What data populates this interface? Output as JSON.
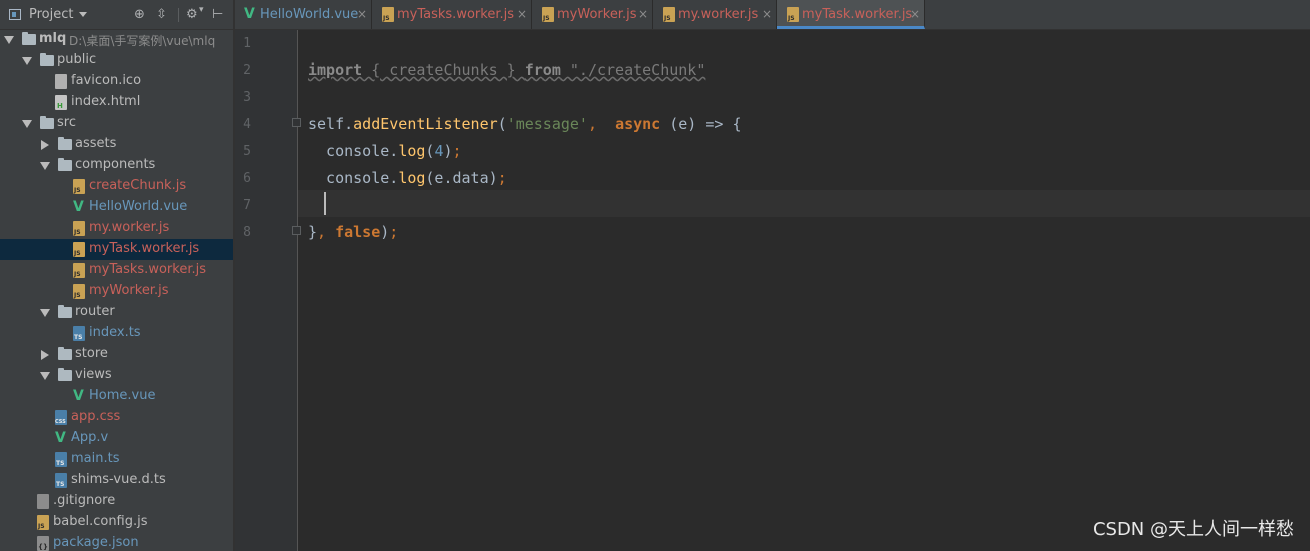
{
  "sidebar": {
    "title": "Project",
    "tree": [
      {
        "label": "mlq",
        "path": "D:\\桌面\\手写案例\\vue\\mlq",
        "kind": "folder",
        "expanded": true
      },
      {
        "label": "public",
        "kind": "folder",
        "expanded": true
      },
      {
        "label": "favicon.ico",
        "kind": "ico",
        "color": "#bbbbbb"
      },
      {
        "label": "index.html",
        "kind": "html",
        "color": "#bbbbbb"
      },
      {
        "label": "src",
        "kind": "folder",
        "expanded": true
      },
      {
        "label": "assets",
        "kind": "folder",
        "expanded": false
      },
      {
        "label": "components",
        "kind": "folder",
        "expanded": true
      },
      {
        "label": "createChunk.js",
        "kind": "js",
        "color": "#c8615a"
      },
      {
        "label": "HelloWorld.vue",
        "kind": "vue",
        "color": "#6897bb"
      },
      {
        "label": "my.worker.js",
        "kind": "js",
        "color": "#c8615a"
      },
      {
        "label": "myTask.worker.js",
        "kind": "js",
        "color": "#c8615a",
        "selected": true
      },
      {
        "label": "myTasks.worker.js",
        "kind": "js",
        "color": "#c8615a"
      },
      {
        "label": "myWorker.js",
        "kind": "js",
        "color": "#c8615a"
      },
      {
        "label": "router",
        "kind": "folder",
        "expanded": true
      },
      {
        "label": "index.ts",
        "kind": "ts",
        "color": "#6897bb"
      },
      {
        "label": "store",
        "kind": "folder",
        "expanded": false
      },
      {
        "label": "views",
        "kind": "folder",
        "expanded": true
      },
      {
        "label": "Home.vue",
        "kind": "vue",
        "color": "#6897bb"
      },
      {
        "label": "app.css",
        "kind": "css",
        "color": "#c8615a"
      },
      {
        "label": "App.v",
        "kind": "vue",
        "color": "#6897bb"
      },
      {
        "label": "main.ts",
        "kind": "ts",
        "color": "#6897bb"
      },
      {
        "label": "shims-vue.d.ts",
        "kind": "ts",
        "color": "#bbbbbb"
      },
      {
        "label": ".gitignore",
        "kind": "text",
        "color": "#bbbbbb"
      },
      {
        "label": "babel.config.js",
        "kind": "js",
        "color": "#bbbbbb"
      },
      {
        "label": "package.json",
        "kind": "json",
        "color": "#6897bb"
      }
    ]
  },
  "tabs": [
    {
      "label": "HelloWorld.vue",
      "kind": "vue",
      "color": "#6897bb",
      "active": false
    },
    {
      "label": "myTasks.worker.js",
      "kind": "js",
      "color": "#c8615a",
      "active": false
    },
    {
      "label": "myWorker.js",
      "kind": "js",
      "color": "#c8615a",
      "active": false
    },
    {
      "label": "my.worker.js",
      "kind": "js",
      "color": "#c8615a",
      "active": false
    },
    {
      "label": "myTask.worker.js",
      "kind": "js",
      "color": "#c8615a",
      "active": true
    }
  ],
  "editor": {
    "line_numbers": [
      "1",
      "2",
      "3",
      "4",
      "5",
      "6",
      "7",
      "8"
    ],
    "current_line": 7,
    "lines": [
      [],
      [
        {
          "t": "import",
          "c": "kw-dim"
        },
        {
          "t": " { createChunks } ",
          "c": "dim"
        },
        {
          "t": "from",
          "c": "kw-dim"
        },
        {
          "t": " \"./createChunk\"",
          "c": "dim"
        }
      ],
      [],
      [
        {
          "t": "self.",
          "c": "plain"
        },
        {
          "t": "addEventListener",
          "c": "fn"
        },
        {
          "t": "(",
          "c": "plain"
        },
        {
          "t": "'message'",
          "c": "str"
        },
        {
          "t": ",  ",
          "c": "punc"
        },
        {
          "t": "async",
          "c": "kw"
        },
        {
          "t": " (e) => {",
          "c": "plain"
        }
      ],
      [
        {
          "t": "  console.",
          "c": "plain"
        },
        {
          "t": "log",
          "c": "fn"
        },
        {
          "t": "(",
          "c": "plain"
        },
        {
          "t": "4",
          "c": "num"
        },
        {
          "t": ")",
          "c": "plain"
        },
        {
          "t": ";",
          "c": "punc"
        }
      ],
      [
        {
          "t": "  console.",
          "c": "plain"
        },
        {
          "t": "log",
          "c": "fn"
        },
        {
          "t": "(e.data)",
          "c": "plain"
        },
        {
          "t": ";",
          "c": "punc"
        }
      ],
      [],
      [
        {
          "t": "}",
          "c": "plain"
        },
        {
          "t": ", ",
          "c": "punc"
        },
        {
          "t": "false",
          "c": "kw"
        },
        {
          "t": ")",
          "c": "plain"
        },
        {
          "t": ";",
          "c": "punc"
        }
      ]
    ]
  },
  "watermark": "CSDN @天上人间一样愁"
}
